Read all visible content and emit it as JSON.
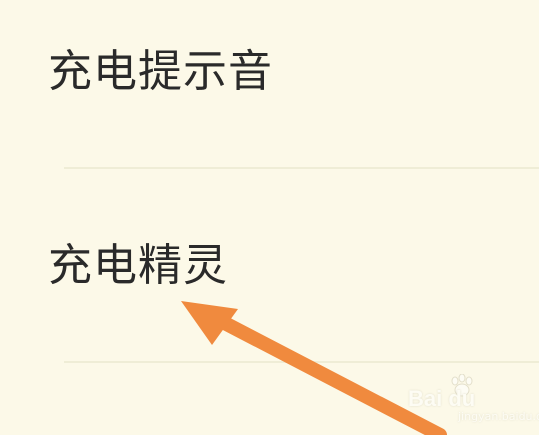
{
  "settings": {
    "items": [
      {
        "label": "充电提示音"
      },
      {
        "label": "充电精灵"
      }
    ]
  },
  "annotation": {
    "arrow_color": "#f08a3e",
    "target": "充电精灵"
  },
  "watermark": {
    "brand": "Bai du",
    "sub": "jingyan.baidu.com"
  },
  "colors": {
    "background": "#fcf9e8",
    "divider": "#efedd6",
    "text": "#2a2a2a"
  }
}
